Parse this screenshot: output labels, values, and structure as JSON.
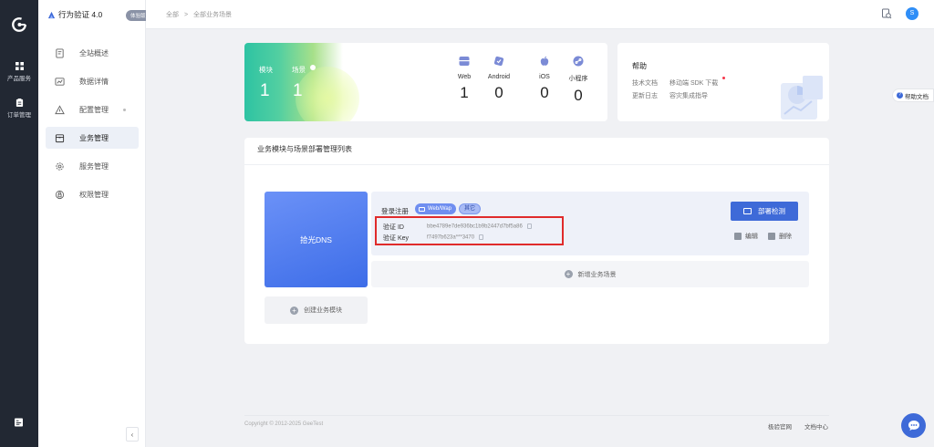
{
  "rail": {
    "items": [
      {
        "label": "产品服务",
        "icon": "grid-icon"
      },
      {
        "label": "订单管理",
        "icon": "clipboard-icon"
      }
    ]
  },
  "sidebar": {
    "brand_title": "行为验证 4.0",
    "brand_badge": "体验版",
    "items": [
      {
        "label": "全站概述",
        "icon": "document-icon"
      },
      {
        "label": "数据详情",
        "icon": "chart-icon"
      },
      {
        "label": "配置管理",
        "icon": "warning-icon"
      },
      {
        "label": "业务管理",
        "icon": "briefcase-icon",
        "active": true
      },
      {
        "label": "服务管理",
        "icon": "gear-icon"
      },
      {
        "label": "权限管理",
        "icon": "lock-icon"
      }
    ]
  },
  "topbar": {
    "breadcrumb": [
      "全部",
      ">",
      "全部业务场景"
    ],
    "avatar": "S"
  },
  "stats": {
    "module_label": "模块",
    "module_value": "1",
    "scene_label": "场景",
    "scene_value": "1",
    "platforms": [
      {
        "name": "Web",
        "value": "1",
        "icon": "web-icon"
      },
      {
        "name": "Android",
        "value": "0",
        "icon": "android-icon"
      },
      {
        "name": "iOS",
        "value": "0",
        "icon": "apple-icon"
      },
      {
        "name": "小程序",
        "value": "0",
        "icon": "miniprogram-icon"
      }
    ]
  },
  "help": {
    "title": "帮助",
    "tech_docs": "技术文档",
    "sdk_download": "移动端 SDK 下载",
    "changelog": "更新日志",
    "integration_guide": "容灾集成指导"
  },
  "side_help": "帮助文档",
  "panel": {
    "title": "业务模块与场景部署管理列表",
    "module_name": "拾光DNS",
    "create_module": "创建业务模块",
    "scene": {
      "name": "登录注册",
      "tag_platform": "Web/Wap",
      "tag_other": "其它",
      "id_label": "验证 ID",
      "id_value": "bbe4789e7de936bc1b9b2447d7bf5a86",
      "key_label": "验证 Key",
      "key_value": "f7497b623a***3470",
      "deploy_button": "部署检测",
      "edit": "编辑",
      "delete": "删除"
    },
    "add_scene": "新增业务场景"
  },
  "footer": {
    "copyright": "Copyright © 2012-2025 GeeTest",
    "link_official": "极验官网",
    "link_docs": "文档中心"
  },
  "colors": {
    "accent": "#3e6ad8",
    "rail": "#222833",
    "highlight_border": "#e02b2b"
  }
}
